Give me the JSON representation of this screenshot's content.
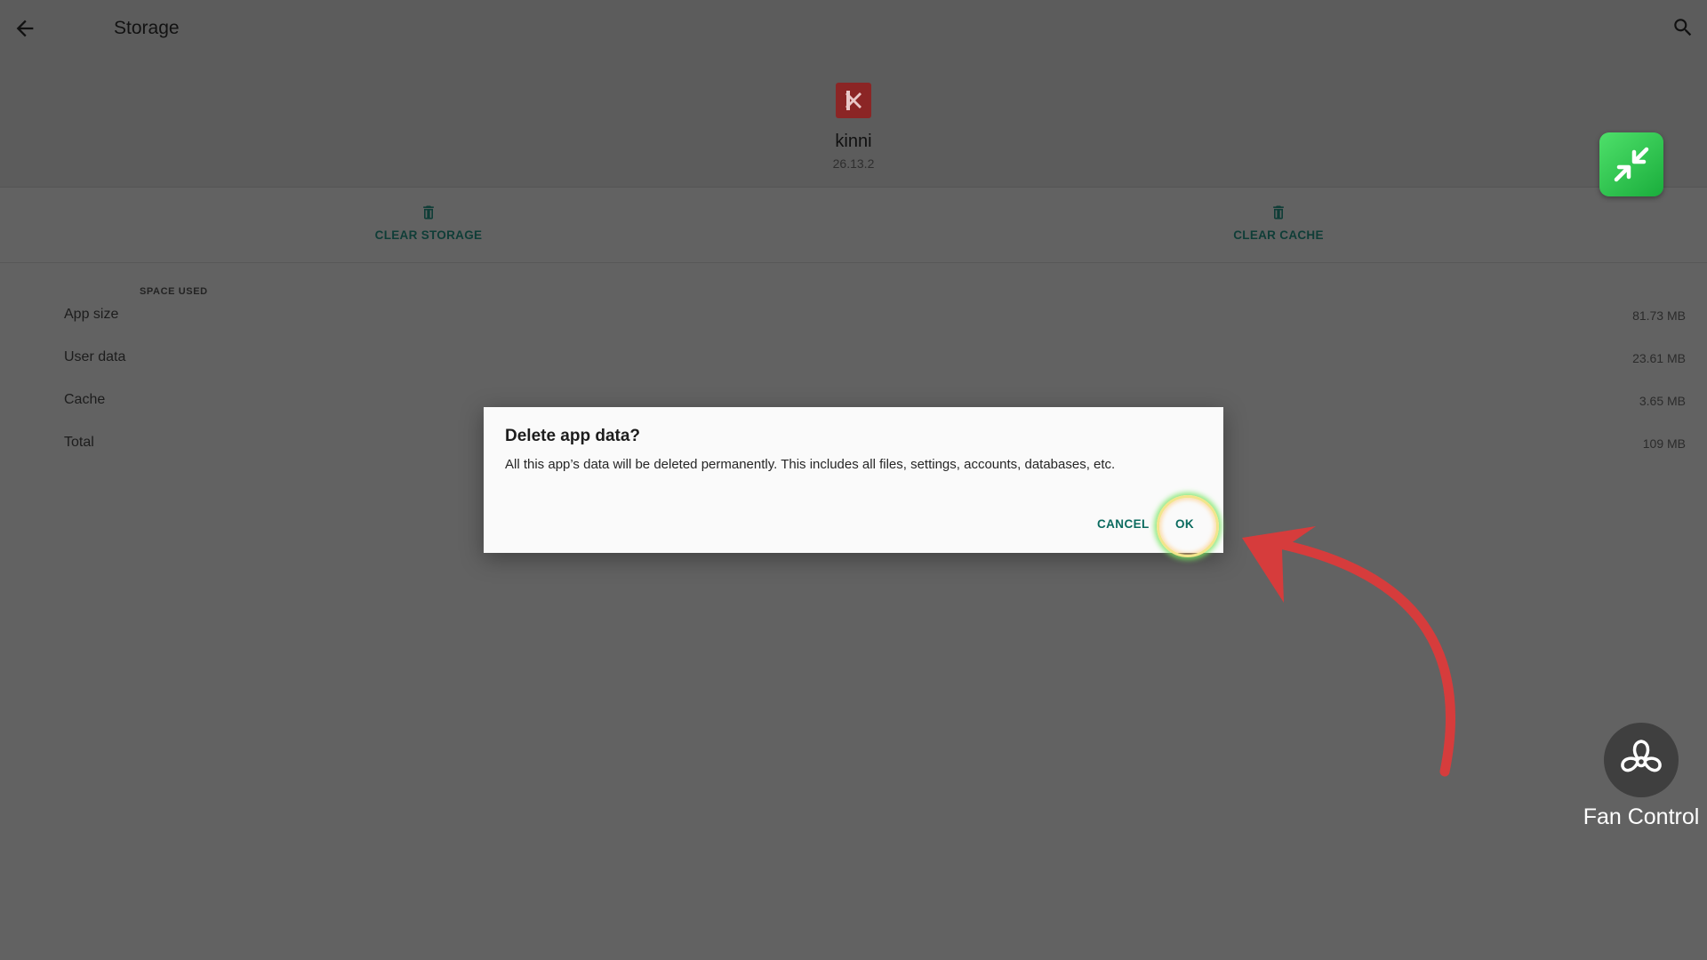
{
  "header": {
    "title": "Storage"
  },
  "app": {
    "name": "kinni",
    "version": "26.13.2"
  },
  "actions": {
    "clear_storage": "CLEAR STORAGE",
    "clear_cache": "CLEAR CACHE"
  },
  "space_used": {
    "header": "SPACE USED",
    "rows": [
      {
        "label": "App size",
        "value": "81.73 MB"
      },
      {
        "label": "User data",
        "value": "23.61 MB"
      },
      {
        "label": "Cache",
        "value": "3.65 MB"
      },
      {
        "label": "Total",
        "value": "109 MB"
      }
    ]
  },
  "dialog": {
    "title": "Delete app data?",
    "message": "All this app’s data will be deleted permanently. This includes all files, settings, accounts, databases, etc.",
    "cancel": "CANCEL",
    "ok": "OK"
  },
  "overlay": {
    "fan_label": "Fan Control",
    "arrow_color": "#d63c3c",
    "highlight_colors": [
      "#f2e58c",
      "#78e664"
    ]
  },
  "icons": [
    "back-arrow-icon",
    "search-icon",
    "app-icon",
    "trash-icon",
    "trash-icon",
    "shrink-icon",
    "fan-icon",
    "annotation-arrow"
  ],
  "colors": {
    "accent": "#0b6b5f",
    "scrim": "#626262",
    "dialog_bg": "#fafafa",
    "pip_green": "#2ec44e"
  }
}
